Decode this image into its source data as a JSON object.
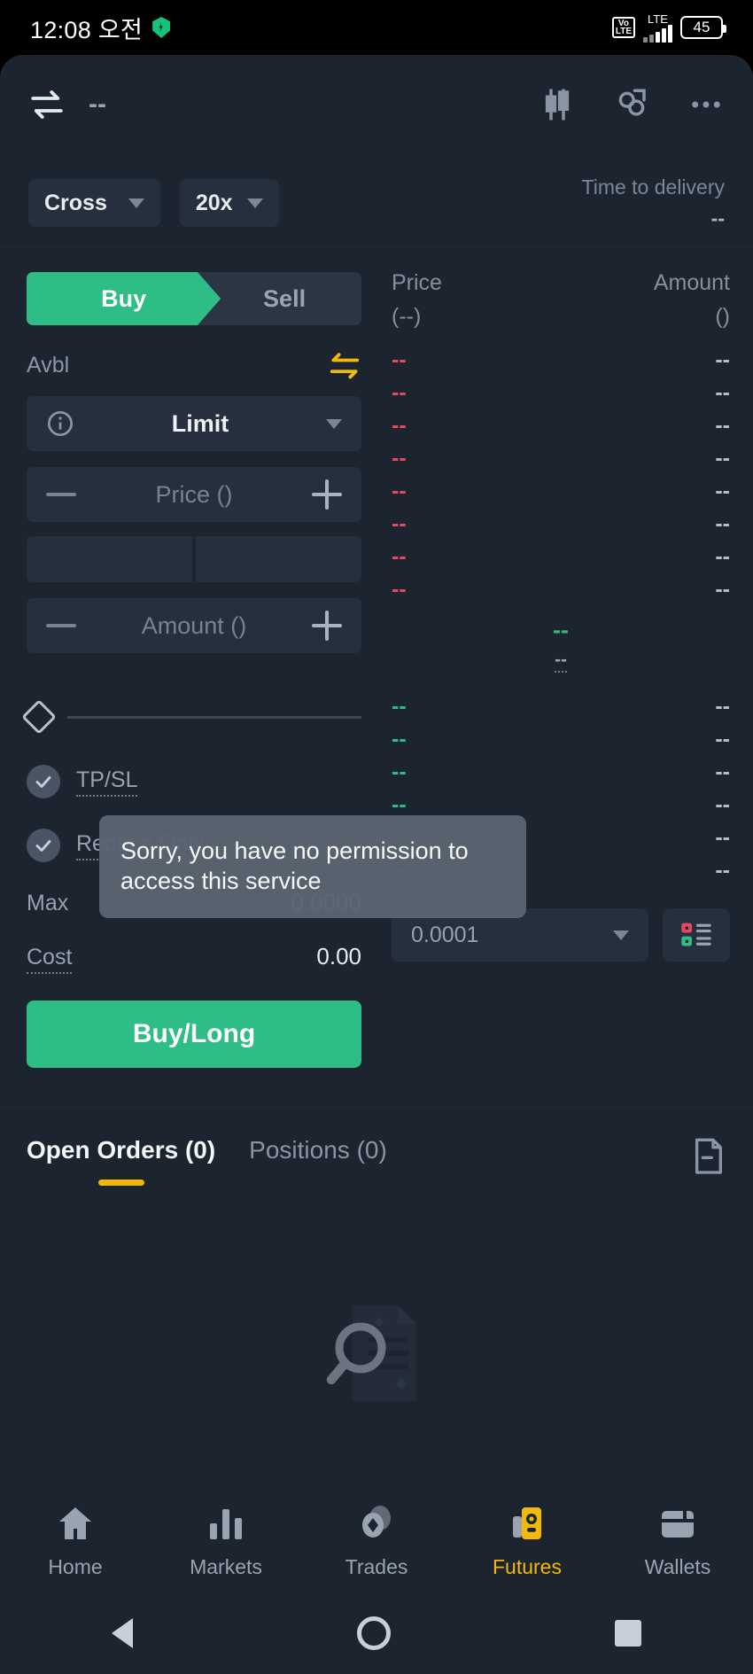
{
  "status_bar": {
    "time": "12:08 오전",
    "shield_icon": "shield-icon",
    "volte_line1": "Vo",
    "volte_line2": "LTE",
    "network": "LTE",
    "battery": "45"
  },
  "top_bar": {
    "swap_icon": "swap-arrows-icon",
    "pair": "--",
    "candles_icon": "candlestick-chart-icon",
    "calculator_icon": "calculator-icon",
    "more_icon": "more-options-icon"
  },
  "leverage": {
    "margin_mode": "Cross",
    "leverage_value": "20x",
    "delivery_label": "Time to delivery",
    "delivery_value": "--"
  },
  "order_form": {
    "buy_tab": "Buy",
    "sell_tab": "Sell",
    "avbl_label": "Avbl",
    "transfer_icon": "transfer-arrows-icon",
    "order_type": "Limit",
    "info_icon": "info-icon",
    "price_placeholder": "Price ()",
    "amount_placeholder": "Amount ()",
    "minus_icon": "minus-icon",
    "plus_icon": "plus-icon",
    "slider_value": 0,
    "tpsl_label": "TP/SL",
    "reduce_only_label": "Reduce Only",
    "checked_icon": "check-circle-icon",
    "max_label": "Max",
    "max_value": "0.0000",
    "cost_label": "Cost",
    "cost_value": "0.00",
    "submit_label": "Buy/Long"
  },
  "order_book": {
    "price_header": "Price",
    "price_unit": "(--)",
    "amount_header": "Amount",
    "amount_unit": "()",
    "asks": [
      {
        "price": "--",
        "amount": "--"
      },
      {
        "price": "--",
        "amount": "--"
      },
      {
        "price": "--",
        "amount": "--"
      },
      {
        "price": "--",
        "amount": "--"
      },
      {
        "price": "--",
        "amount": "--"
      },
      {
        "price": "--",
        "amount": "--"
      },
      {
        "price": "--",
        "amount": "--"
      },
      {
        "price": "--",
        "amount": "--"
      }
    ],
    "mid_price": "--",
    "mid_sub": "--",
    "bids": [
      {
        "price": "--",
        "amount": "--"
      },
      {
        "price": "--",
        "amount": "--"
      },
      {
        "price": "--",
        "amount": "--"
      },
      {
        "price": "--",
        "amount": "--"
      },
      {
        "price": "--",
        "amount": "--"
      },
      {
        "price": "--",
        "amount": "--"
      }
    ],
    "tick_size": "0.0001",
    "display_mode_icon": "orderbook-layout-icon"
  },
  "toast": {
    "message": "Sorry, you have no permission to access this service"
  },
  "tabs": {
    "open_orders": "Open Orders (0)",
    "positions": "Positions (0)",
    "history_icon": "order-history-icon",
    "empty_icon": "no-records-icon"
  },
  "bottom_nav": {
    "items": [
      {
        "label": "Home",
        "icon": "home-icon",
        "active": false
      },
      {
        "label": "Markets",
        "icon": "markets-bars-icon",
        "active": false
      },
      {
        "label": "Trades",
        "icon": "trades-icon",
        "active": false
      },
      {
        "label": "Futures",
        "icon": "futures-icon",
        "active": true
      },
      {
        "label": "Wallets",
        "icon": "wallets-icon",
        "active": false
      }
    ]
  },
  "system_nav": {
    "back_icon": "android-back-icon",
    "home_icon": "android-home-icon",
    "recents_icon": "android-recents-icon"
  },
  "colors": {
    "buy_green": "#2ebd85",
    "sell_red": "#e4495f",
    "accent_yellow": "#f0b90b",
    "bg": "#1c2430",
    "panel": "#252f3d"
  }
}
